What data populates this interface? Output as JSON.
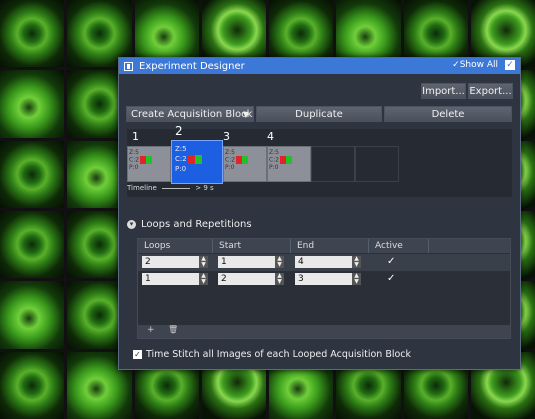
{
  "dialog": {
    "title": "Experiment Designer",
    "show_all": "✓Show All",
    "show_all_checked": true
  },
  "toolbar": {
    "import": "Import...",
    "export": "Export...",
    "create_block": "Create Acquisition Block",
    "duplicate": "Duplicate",
    "delete": "Delete"
  },
  "blocks": [
    {
      "number": "1",
      "z": "Z:5",
      "c": "C:2",
      "p": "P:0",
      "selected": false
    },
    {
      "number": "2",
      "z": "Z:5",
      "c": "C:2",
      "p": "P:0",
      "selected": true
    },
    {
      "number": "3",
      "z": "Z:5",
      "c": "C:2",
      "p": "P:0",
      "selected": false
    },
    {
      "number": "4",
      "z": "Z:5",
      "c": "C:2",
      "p": "P:0",
      "selected": false
    }
  ],
  "timeline": {
    "label": "Timeline",
    "duration": "> 9 s"
  },
  "loops": {
    "section_title": "Loops and Repetitions",
    "headers": [
      "Loops",
      "Start",
      "End",
      "Active"
    ],
    "rows": [
      {
        "loops": "2",
        "start": "1",
        "end": "4",
        "active": "✓"
      },
      {
        "loops": "1",
        "start": "2",
        "end": "3",
        "active": "✓"
      }
    ],
    "add": "+",
    "remove": "🗑"
  },
  "stitch": {
    "label": "Time Stitch all Images of each Looped Acquisition Block",
    "checked": "✓"
  },
  "colors": {
    "accent": "#3b78d8",
    "dialog_bg": "#2f3540",
    "channel_red": "#e0242a",
    "channel_green": "#22c12a"
  }
}
